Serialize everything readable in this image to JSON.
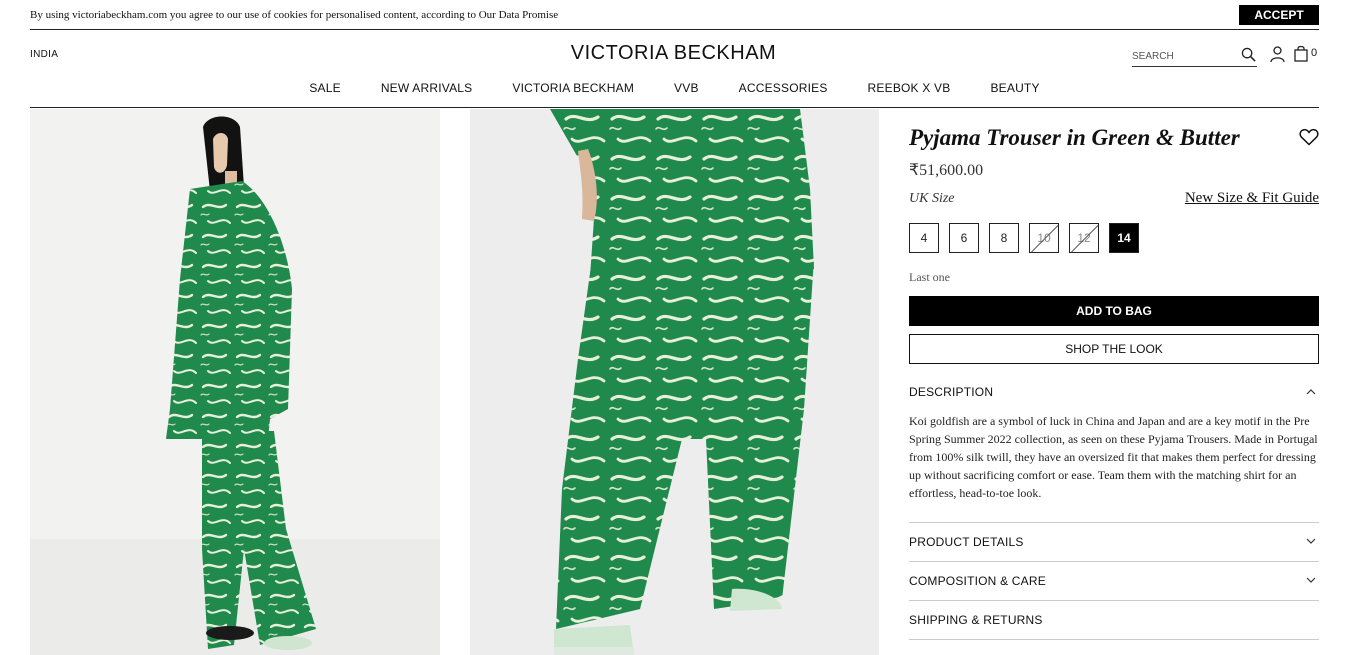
{
  "cookie": {
    "text": "By using victoriabeckham.com you agree to our use of cookies for personalised content, according to Our Data Promise",
    "accept_label": "ACCEPT"
  },
  "header": {
    "region": "INDIA",
    "brand": "VICTORIA BECKHAM",
    "search_placeholder": "SEARCH",
    "bag_count": "0"
  },
  "nav": [
    "SALE",
    "NEW ARRIVALS",
    "VICTORIA BECKHAM",
    "VVB",
    "ACCESSORIES",
    "REEBOK X VB",
    "BEAUTY"
  ],
  "product": {
    "title": "Pyjama Trouser in Green & Butter",
    "price": "₹51,600.00",
    "size_label": "UK Size",
    "size_guide": "New Size & Fit Guide",
    "sizes": [
      {
        "label": "4",
        "state": "available"
      },
      {
        "label": "6",
        "state": "available"
      },
      {
        "label": "8",
        "state": "available"
      },
      {
        "label": "10",
        "state": "unavailable"
      },
      {
        "label": "12",
        "state": "unavailable"
      },
      {
        "label": "14",
        "state": "selected"
      }
    ],
    "stock_note": "Last one",
    "add_to_bag": "ADD TO BAG",
    "shop_the_look": "SHOP THE LOOK"
  },
  "accordion": {
    "description": {
      "label": "DESCRIPTION",
      "text": "Koi goldfish are a symbol of luck in China and Japan and are a key motif in the Pre Spring Summer 2022 collection, as seen on these Pyjama Trousers. Made in Portugal from 100% silk twill, they have an oversized fit that makes them perfect for dressing up without sacrificing comfort or ease. Team them with the matching shirt for an effortless, head-to-toe look."
    },
    "product_details": "PRODUCT DETAILS",
    "composition": "COMPOSITION & CARE",
    "shipping": "SHIPPING & RETURNS"
  },
  "colors": {
    "garment_green": "#1f8a4c",
    "print_cream": "#e8efd9",
    "black": "#000000"
  },
  "icons": [
    "search-icon",
    "user-icon",
    "bag-icon",
    "heart-icon",
    "chevron-up-icon",
    "chevron-down-icon"
  ]
}
